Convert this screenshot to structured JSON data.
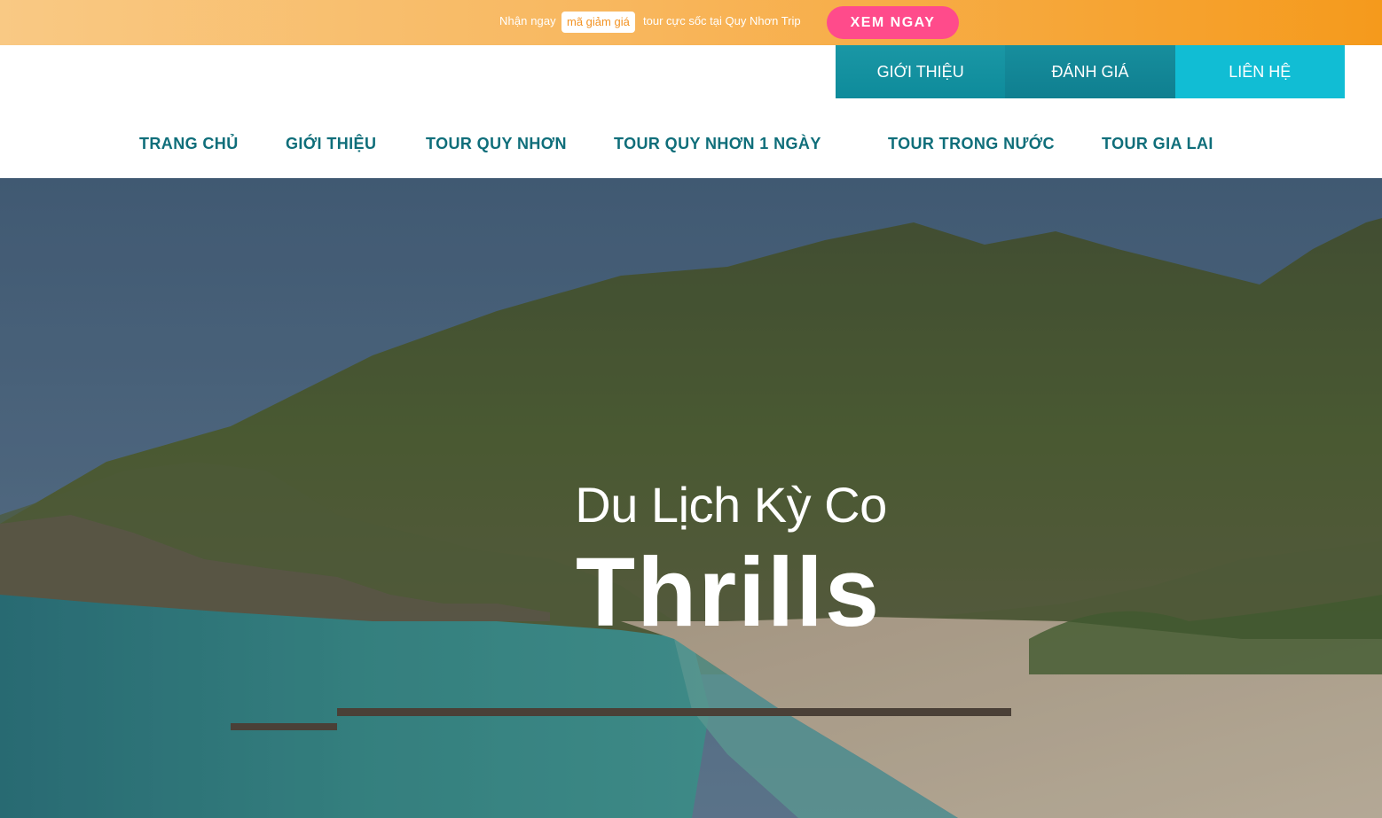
{
  "promo": {
    "prefix": "Nhận ngay",
    "badge": "mã giảm giá",
    "suffix": "tour cực sốc tại Quy Nhơn Trip",
    "button_label": "XEM NGAY"
  },
  "top_tabs": [
    {
      "label": "GIỚI THIỆU"
    },
    {
      "label": "ĐÁNH GIÁ"
    },
    {
      "label": "LIÊN HỆ"
    }
  ],
  "main_nav": [
    {
      "label": "TRANG CHỦ"
    },
    {
      "label": "GIỚI THIỆU"
    },
    {
      "label": "TOUR QUY NHƠN"
    },
    {
      "label": "TOUR QUY NHƠN 1 NGÀY"
    },
    {
      "label": "TOUR TRONG NƯỚC"
    },
    {
      "label": "TOUR GIA LAI"
    }
  ],
  "hero": {
    "subtitle": "Du Lịch Kỳ Co",
    "title": "Thrills"
  },
  "colors": {
    "promo_accent": "#f39323",
    "button_pink": "#ff4b8b",
    "nav_teal": "#0f6e7a",
    "tab_teal": "#0e8b9b",
    "tab_cyan": "#11bdd4"
  }
}
